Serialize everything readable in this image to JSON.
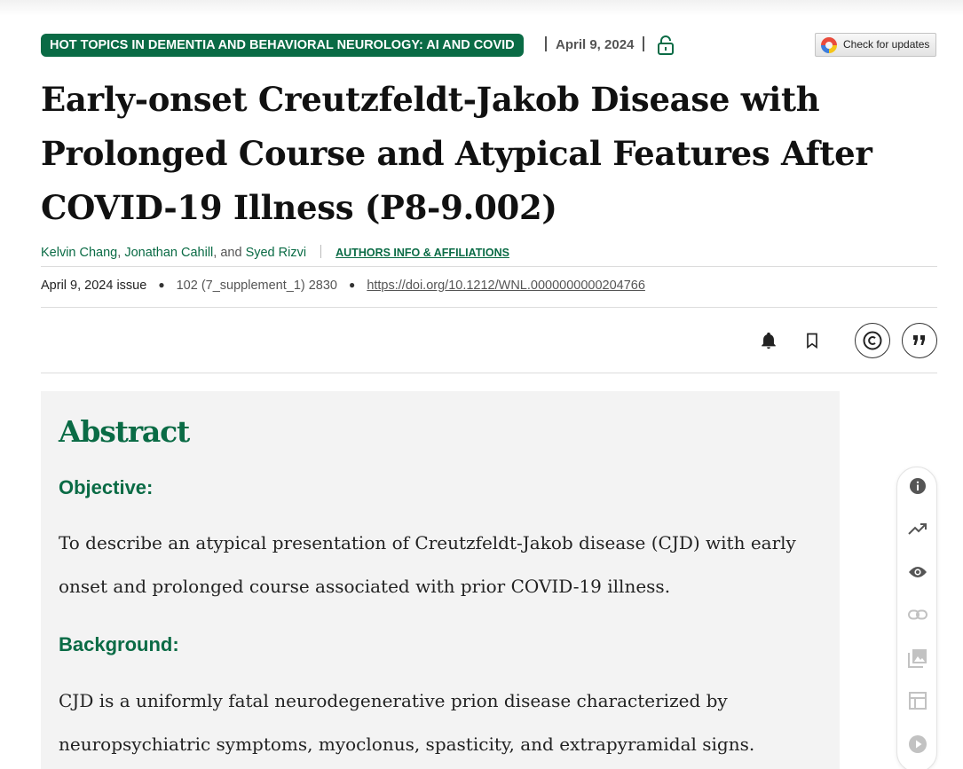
{
  "header": {
    "topic_badge": "HOT TOPICS IN DEMENTIA AND BEHAVIORAL NEUROLOGY: AI AND COVID",
    "pub_date": "April 9, 2024",
    "lock_icon": "open-access-lock-icon",
    "check_updates_label": "Check for updates"
  },
  "article": {
    "title": "Early-onset Creutzfeldt-Jakob Disease with Prolonged Course and Atypical Features After COVID-19 Illness (P8-9.002)",
    "authors": [
      "Kelvin Chang",
      "Jonathan Cahill",
      "Syed Rizvi"
    ],
    "author_sep": ",",
    "author_and": ", and",
    "affiliations_link": "AUTHORS INFO & AFFILIATIONS",
    "issue": "April 9, 2024 issue",
    "volume": "102 (7_supplement_1) 2830",
    "doi": "https://doi.org/10.1212/WNL.0000000000204766"
  },
  "toolbar": {
    "icons": [
      "bell-icon",
      "bookmark-icon",
      "copyright-icon",
      "quote-icon"
    ]
  },
  "abstract": {
    "title": "Abstract",
    "sections": [
      {
        "heading": "Objective:",
        "lines": [
          "To describe an atypical presentation of Creutzfeldt-Jakob disease (CJD) with early",
          "onset and prolonged course associated with prior COVID-19 illness."
        ]
      },
      {
        "heading": "Background:",
        "lines": [
          "CJD is a uniformly fatal neurodegenerative prion disease characterized by",
          "neuropsychiatric symptoms, myoclonus, spasticity, and extrapyramidal signs."
        ]
      }
    ]
  },
  "side_rail": {
    "icons": [
      "info-icon",
      "trending-icon",
      "eye-icon",
      "link-icon",
      "image-icon",
      "table-icon",
      "play-icon"
    ]
  }
}
